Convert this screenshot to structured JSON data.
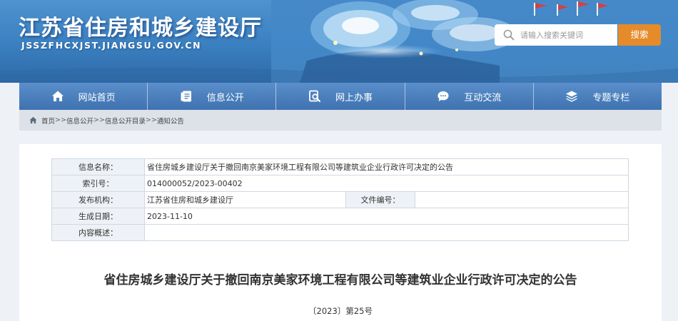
{
  "header": {
    "site_title": "江苏省住房和城乡建设厅",
    "site_url": "JSSZFHCXJST.JIANGSU.GOV.CN",
    "search": {
      "placeholder": "请输入搜索关键词",
      "button_label": "搜索",
      "icon": "search-icon",
      "button_color": "#e58b2a"
    }
  },
  "nav": {
    "items": [
      {
        "label": "网站首页",
        "icon": "home-icon"
      },
      {
        "label": "信息公开",
        "icon": "document-icon"
      },
      {
        "label": "网上办事",
        "icon": "search-doc-icon"
      },
      {
        "label": "互动交流",
        "icon": "chat-icon"
      },
      {
        "label": "专题专栏",
        "icon": "layers-icon"
      }
    ]
  },
  "breadcrumb": {
    "items": [
      "首页",
      "信息公开",
      "信息公开目录",
      "通知公告"
    ],
    "separator": ">>"
  },
  "info_table": {
    "name_label": "信息名称：",
    "name_value": "省住房城乡建设厅关于撤回南京美家环境工程有限公司等建筑业企业行政许可决定的公告",
    "index_label": "索引号：",
    "index_value": "014000052/2023-00402",
    "publisher_label": "发布机构：",
    "publisher_value": "江苏省住房和城乡建设厅",
    "docno_label": "文件编号：",
    "docno_value": "",
    "date_label": "生成日期：",
    "date_value": "2023-11-10",
    "summary_label": "内容概述：",
    "summary_value": ""
  },
  "article": {
    "title": "省住房城乡建设厅关于撤回南京美家环境工程有限公司等建筑业企业行政许可决定的公告",
    "number": "〔2023〕第25号"
  }
}
